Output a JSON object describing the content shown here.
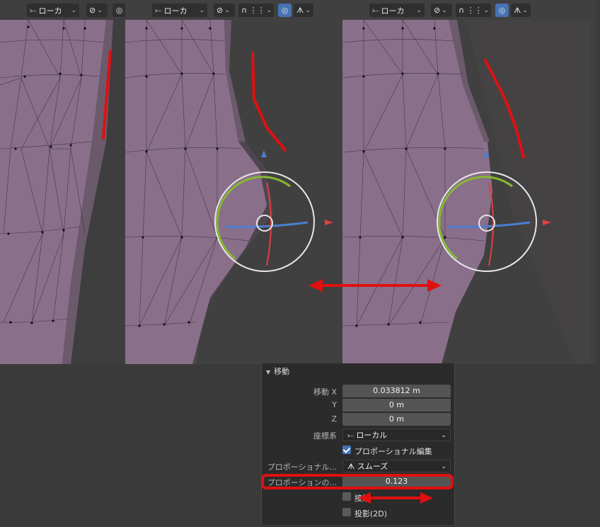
{
  "viewports": [
    {
      "name": "left",
      "header": {
        "orientation_label": "ローカ"
      }
    },
    {
      "name": "middle",
      "header": {
        "orientation_label": "ローカ"
      }
    },
    {
      "name": "right",
      "header": {
        "orientation_label": "ローカ"
      }
    }
  ],
  "icons": {
    "transform_orientation": "orientation-icon",
    "snap": "snap-icon",
    "proportional_edit": "proportional-edit-icon",
    "falloff": "falloff-smooth-icon"
  },
  "colors": {
    "mesh": "#8a6f8b",
    "accent": "#4772b3",
    "annotation_red": "#e01010",
    "gizmo_green": "#86b832",
    "gizmo_blue": "#4a7fd0"
  },
  "panel": {
    "title": "移動",
    "move_x_label": "移動 X",
    "move_x": "0.033812 m",
    "y_label": "Y",
    "move_y": "0 m",
    "z_label": "Z",
    "move_z": "0 m",
    "orientation_label": "座標系",
    "orientation_value": "ローカル",
    "proportional_edit_label": "プロポーショナル編集",
    "proportional_edit_checked": true,
    "falloff_label": "プロポーショナル...",
    "falloff_value": "スムーズ",
    "size_label": "プロポーションの...",
    "size_value": "0.123",
    "connected_label": "接続",
    "connected_checked": false,
    "projected_label": "投影(2D)",
    "projected_checked": false
  }
}
